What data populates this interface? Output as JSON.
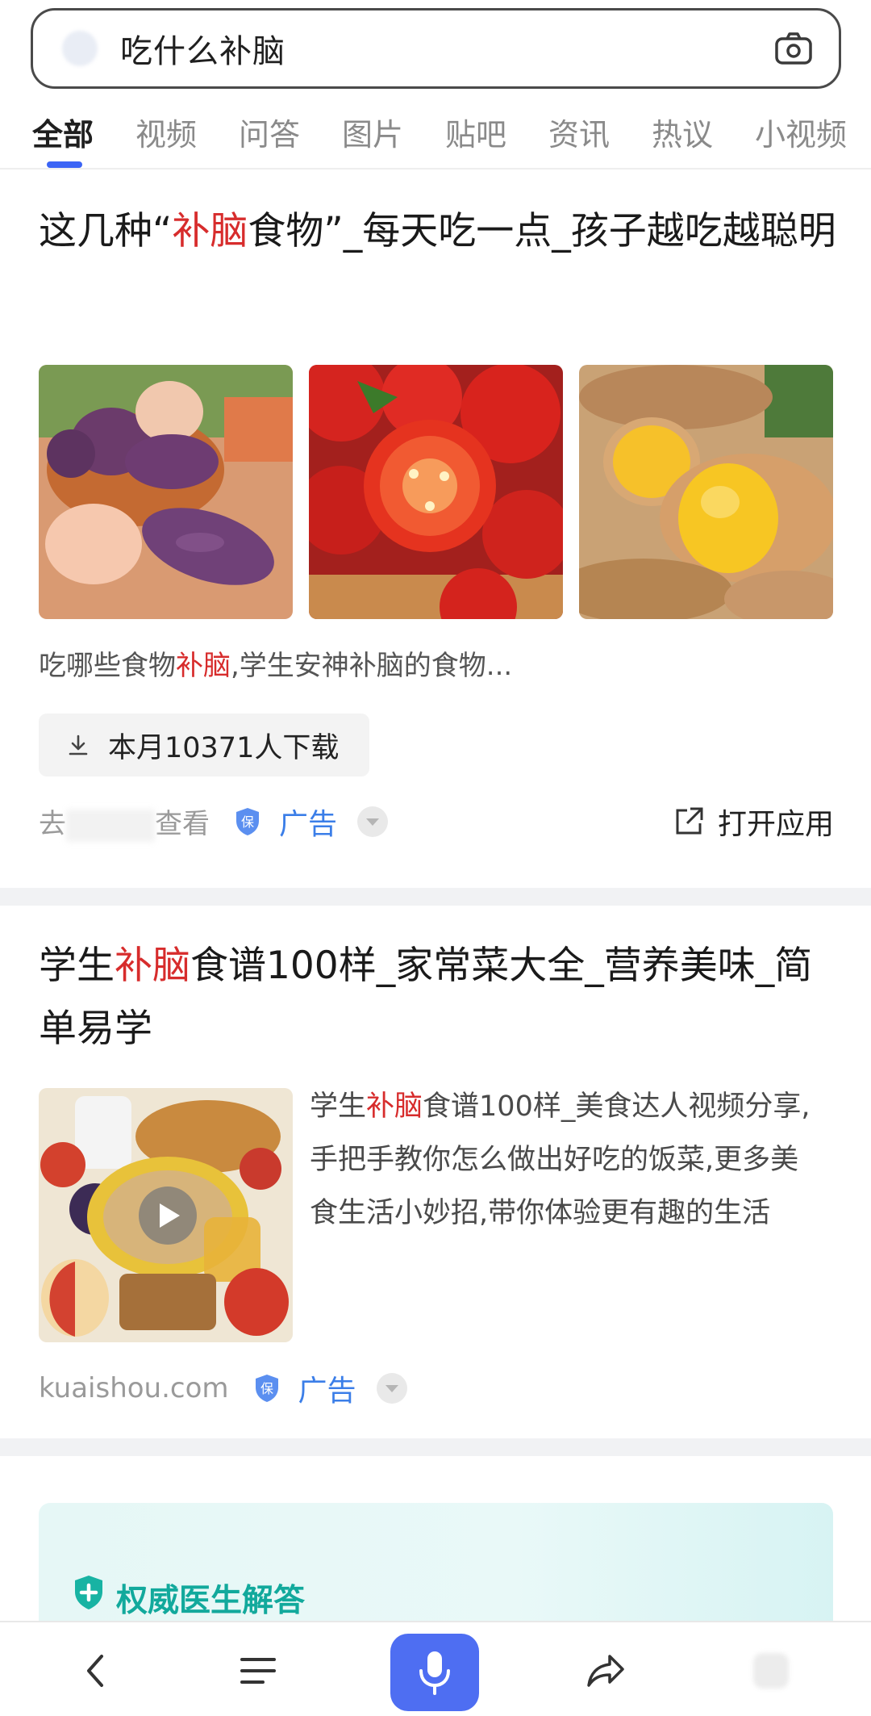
{
  "search": {
    "query": "吃什么补脑"
  },
  "tabs": [
    {
      "label": "全部",
      "active": true
    },
    {
      "label": "视频"
    },
    {
      "label": "问答"
    },
    {
      "label": "图片"
    },
    {
      "label": "贴吧"
    },
    {
      "label": "资讯"
    },
    {
      "label": "热议"
    },
    {
      "label": "小视频"
    }
  ],
  "result1": {
    "title_pre": "这几种“",
    "title_hl": "补脑",
    "title_post": "食物”_每天吃一点_孩子越吃越聪明",
    "images": [
      "purple-sweet-potato-eggs-image",
      "cherry-tomatoes-image",
      "yellow-sweet-potato-image"
    ],
    "desc_pre": "吃哪些食物",
    "desc_hl": "补脑",
    "desc_post": ",学生安神补脑的食物...",
    "download_label": "本月10371人下载",
    "source_pre": "去",
    "source_post": "查看",
    "ad_label": "广告",
    "open_app_label": "打开应用"
  },
  "result2": {
    "title_pre": "学生",
    "title_hl": "补脑",
    "title_post": "食谱100样_家常菜大全_营养美味_简单易学",
    "body_pre": "学生",
    "body_hl": "补脑",
    "body_post": "食谱100样_美食达人视频分享,手把手教你怎么做出好吃的饭菜,更多美食生活小妙招,带你体验更有趣的生活",
    "source": "kuaishou.com",
    "ad_label": "广告"
  },
  "doctor": {
    "title": "权威医生解答"
  },
  "colors": {
    "accent": "#3b64f5",
    "highlight": "#d72c2c",
    "ad": "#3b7ee8",
    "doctor": "#12a99c",
    "mic": "#4e6ef2"
  }
}
